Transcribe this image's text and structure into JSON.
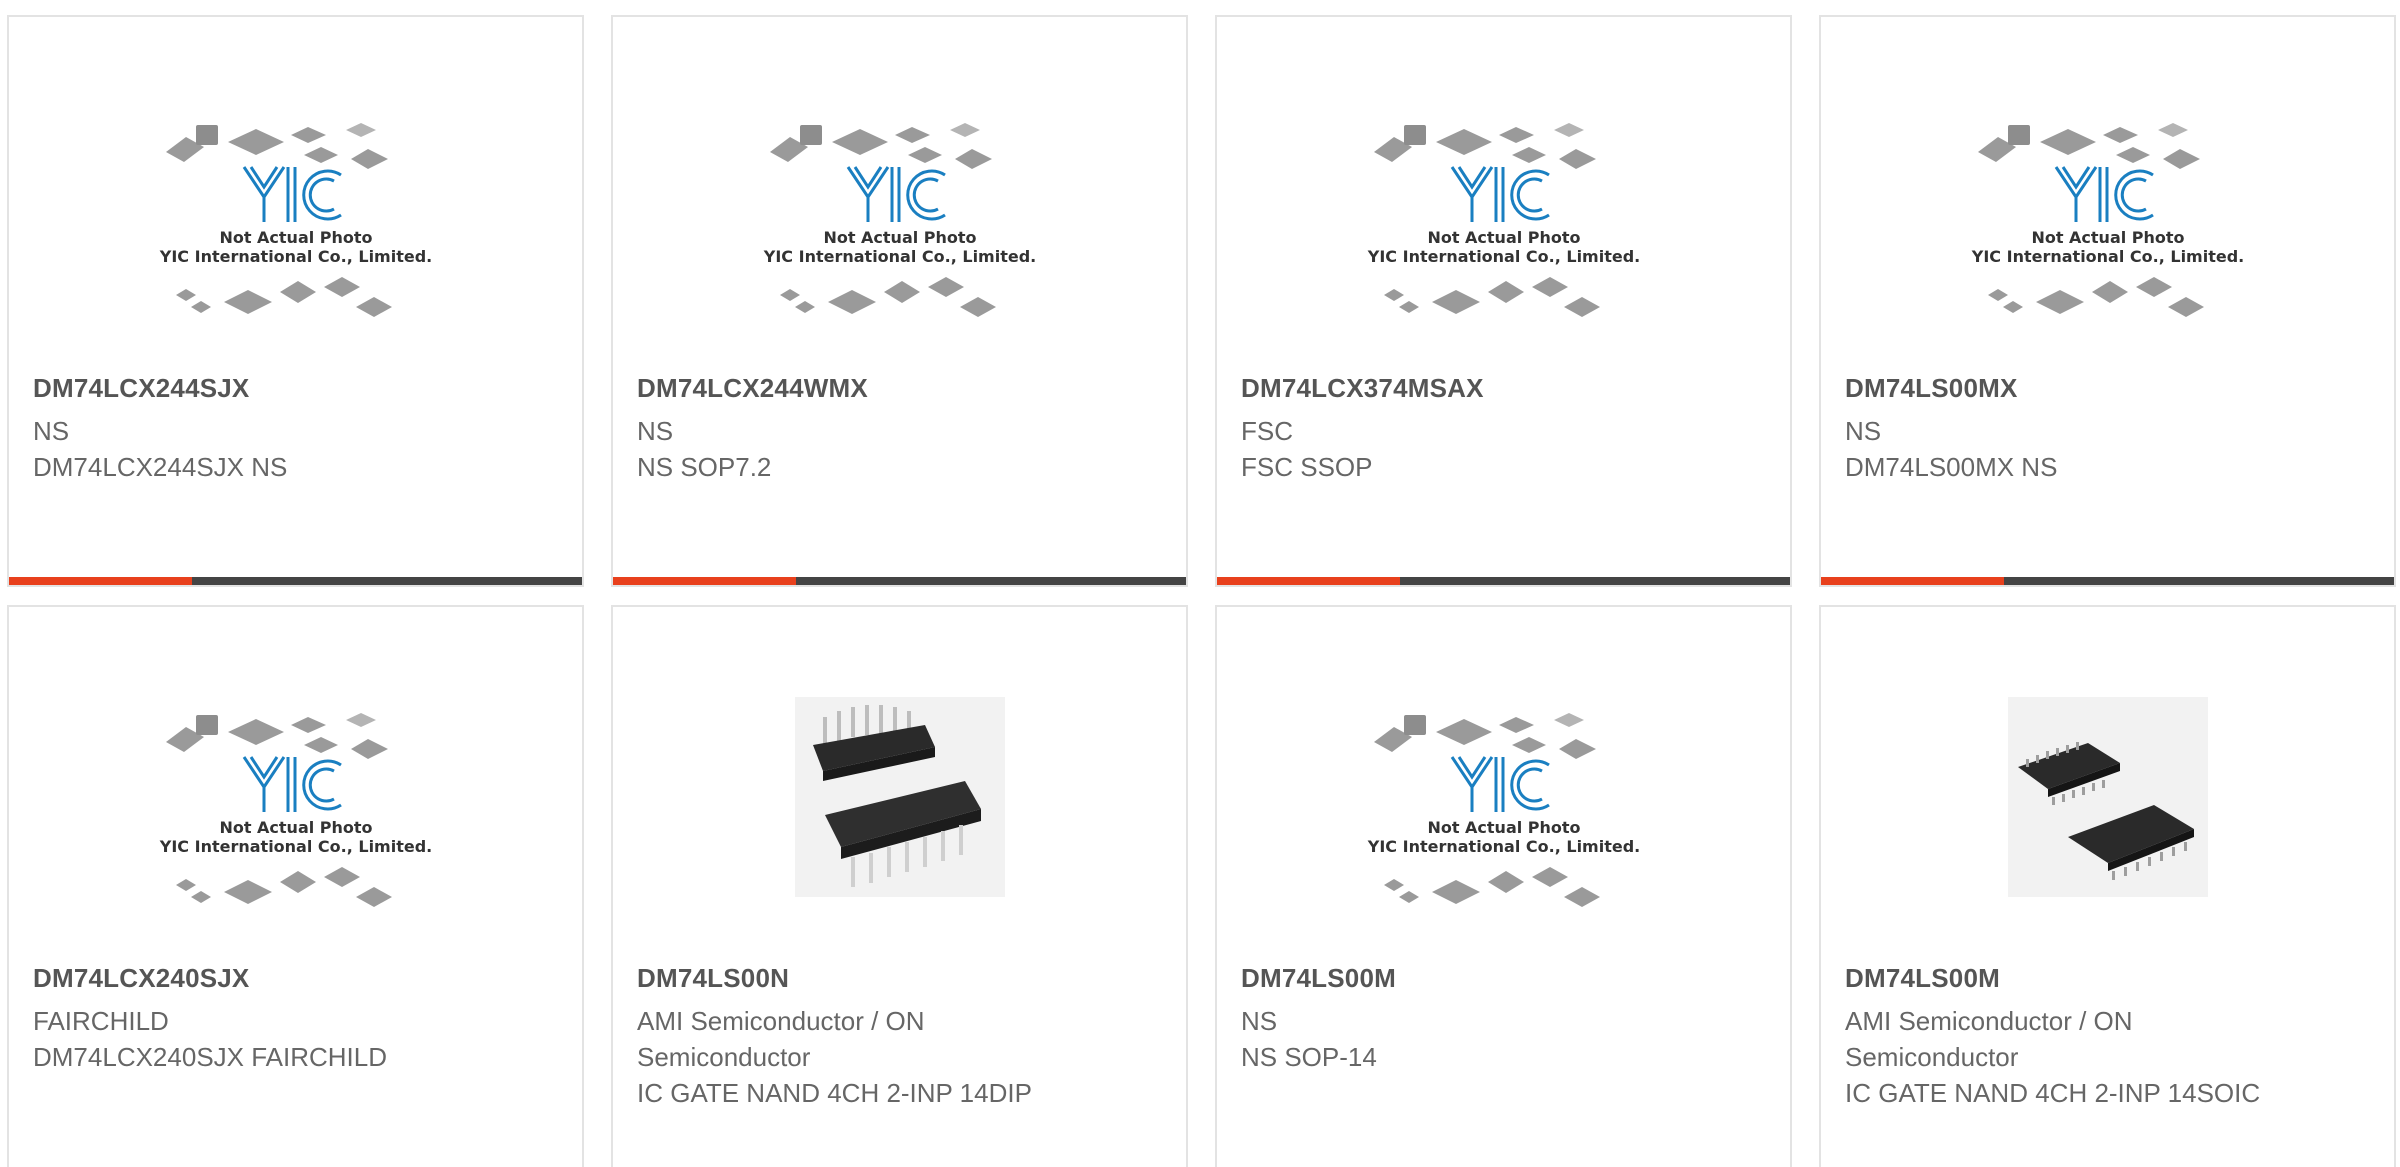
{
  "products": [
    {
      "part": "DM74LCX244SJX",
      "maker": "NS",
      "desc": "DM74LCX244SJX NS",
      "image": "placeholder"
    },
    {
      "part": "DM74LCX244WMX",
      "maker": "NS",
      "desc": "NS SOP7.2",
      "image": "placeholder"
    },
    {
      "part": "DM74LCX374MSAX",
      "maker": "FSC",
      "desc": "FSC SSOP",
      "image": "placeholder"
    },
    {
      "part": "DM74LS00MX",
      "maker": "NS",
      "desc": "DM74LS00MX NS",
      "image": "placeholder"
    },
    {
      "part": "DM74LCX240SJX",
      "maker": "FAIRCHILD",
      "desc": "DM74LCX240SJX FAIRCHILD",
      "image": "placeholder"
    },
    {
      "part": "DM74LS00N",
      "maker": "AMI Semiconductor / ON Semiconductor",
      "desc": "IC GATE NAND 4CH 2-INP 14DIP",
      "image": "dip-chip"
    },
    {
      "part": "DM74LS00M",
      "maker": "NS",
      "desc": "NS SOP-14",
      "image": "placeholder"
    },
    {
      "part": "DM74LS00M",
      "maker": "AMI Semiconductor / ON Semiconductor",
      "desc": "IC GATE NAND 4CH 2-INP 14SOIC",
      "image": "soic-chip"
    }
  ],
  "placeholder": {
    "line1": "Not Actual Photo",
    "line2": "YIC International Co., Limited.",
    "logo": "YIC"
  },
  "colors": {
    "accent": "#e8401c",
    "bar": "#444444",
    "logo": "#1a7fc1"
  }
}
